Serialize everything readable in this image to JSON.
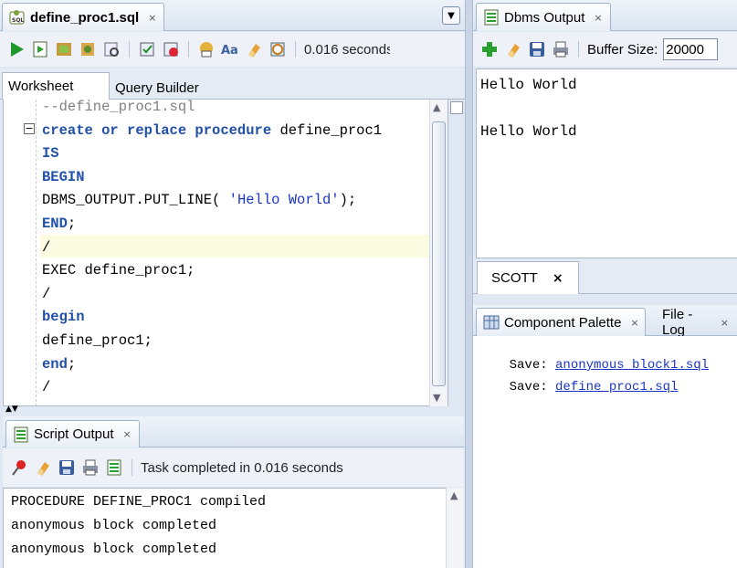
{
  "editor": {
    "tab_title": "define_proc1.sql",
    "tab_close": "×",
    "toolbar_time": "0.016 seconds",
    "subtabs": [
      "Worksheet",
      "Query Builder"
    ],
    "code": [
      {
        "text": "--define_proc1.sql",
        "type": "cmt"
      },
      {
        "parts": [
          [
            "create or replace procedure",
            "kw"
          ],
          [
            " define_proc1",
            ""
          ]
        ]
      },
      {
        "parts": [
          [
            "IS",
            "kw"
          ]
        ]
      },
      {
        "parts": [
          [
            "BEGIN",
            "kw"
          ]
        ]
      },
      {
        "parts": [
          [
            "DBMS_OUTPUT.PUT_LINE( ",
            ""
          ],
          [
            "'Hello World'",
            "str"
          ],
          [
            ");",
            ""
          ]
        ]
      },
      {
        "parts": [
          [
            "END",
            "kw"
          ],
          [
            ";",
            ""
          ]
        ]
      },
      {
        "parts": [
          [
            "/",
            ""
          ]
        ]
      },
      {
        "parts": [
          [
            "EXEC define_proc1;",
            ""
          ]
        ]
      },
      {
        "parts": [
          [
            "/",
            ""
          ]
        ]
      },
      {
        "parts": [
          [
            "begin",
            "kw"
          ]
        ]
      },
      {
        "parts": [
          [
            "define_proc1;",
            ""
          ]
        ]
      },
      {
        "parts": [
          [
            "end",
            "kw"
          ],
          [
            ";",
            ""
          ]
        ]
      },
      {
        "parts": [
          [
            "/",
            ""
          ]
        ]
      }
    ]
  },
  "script_output": {
    "tab_title": "Script Output",
    "tab_close": "×",
    "status": "Task completed in 0.016 seconds",
    "lines": [
      "PROCEDURE DEFINE_PROC1 compiled",
      "anonymous block completed",
      "anonymous block completed"
    ]
  },
  "dbms": {
    "tab_title": "Dbms Output",
    "tab_close": "×",
    "buffer_label": "Buffer Size:",
    "buffer_value": "20000",
    "lines": [
      "Hello World",
      "",
      "Hello World"
    ],
    "conn_tab": "SCOTT",
    "conn_close": "×"
  },
  "bottom_right": {
    "tabs": [
      "Component Palette",
      "File - Log"
    ],
    "tab_close": "×",
    "log": [
      {
        "prefix": "Save: ",
        "file": "anonymous_block1.sql"
      },
      {
        "prefix": "Save: ",
        "file": "define_proc1.sql"
      }
    ]
  }
}
